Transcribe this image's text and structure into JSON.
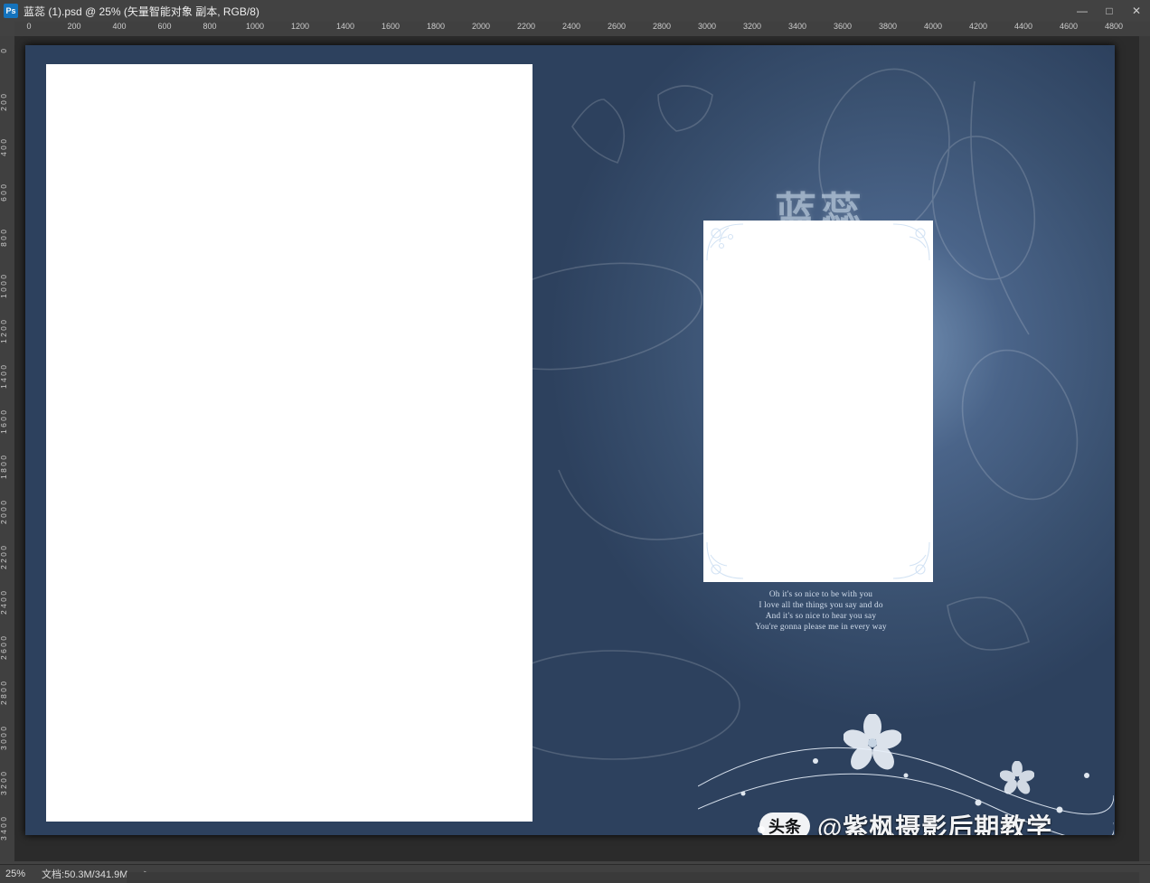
{
  "colors": {
    "accent": "#1473bd",
    "panel": "#404040",
    "canvas": "#2b2b2b"
  },
  "title_bar": {
    "app_badge": "Ps",
    "document_title": "蓝蕊 (1).psd @ 25% (矢量智能对象 副本, RGB/8)"
  },
  "window_controls": {
    "minimize_glyph": "—",
    "maximize_glyph": "□",
    "close_glyph": "✕"
  },
  "ruler": {
    "h_ticks": [
      "0",
      "200",
      "400",
      "600",
      "800",
      "1000",
      "1200",
      "1400",
      "1600",
      "1800",
      "2000",
      "2200",
      "2400",
      "2600",
      "2800",
      "3000",
      "3200",
      "3400",
      "3600",
      "3800",
      "4000",
      "4200",
      "4400",
      "4600",
      "4800"
    ],
    "v_ticks": [
      "0",
      "200",
      "400",
      "600",
      "800",
      "1000",
      "1200",
      "1400",
      "1600",
      "1800",
      "2000",
      "2200",
      "2400",
      "2600",
      "2800",
      "3000",
      "3200",
      "3400"
    ]
  },
  "artwork": {
    "chinese_title": "蓝蕊",
    "poem_lines": [
      "Oh it's so nice to be with you",
      "I love all the things you say and do",
      "And it's so nice to hear you say",
      "You're gonna please me in every way"
    ]
  },
  "watermark": {
    "badge": "头条",
    "handle": "@紫枫摄影后期教学"
  },
  "status_bar": {
    "zoom": "25%",
    "doc_size": "文档:50.3M/341.9M",
    "arrow": "▶"
  }
}
